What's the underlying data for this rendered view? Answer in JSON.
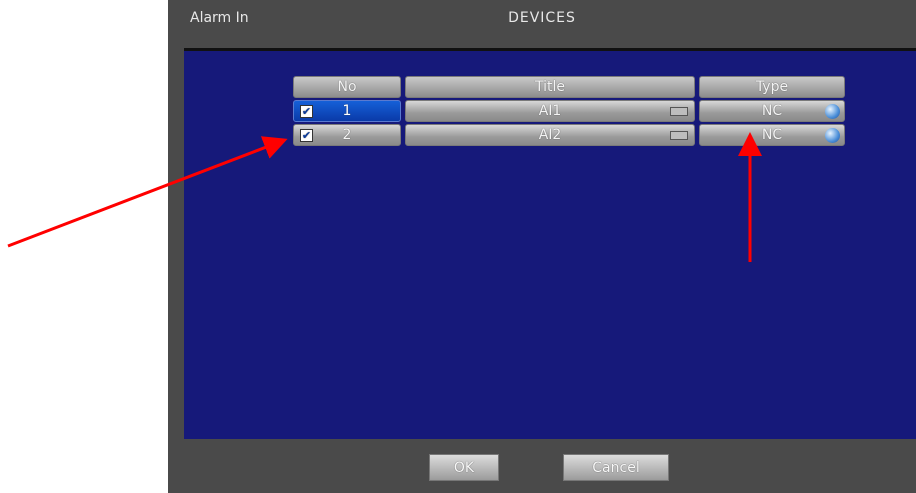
{
  "window": {
    "title_left": "Alarm In",
    "title_center": "DEVICES"
  },
  "table": {
    "headers": [
      "No",
      "Title",
      "Type"
    ],
    "rows": [
      {
        "no": "1",
        "title": "AI1",
        "type": "NC",
        "checked": true,
        "selected": true
      },
      {
        "no": "2",
        "title": "AI2",
        "type": "NC",
        "checked": true,
        "selected": false
      }
    ]
  },
  "buttons": {
    "ok": "OK",
    "cancel": "Cancel"
  },
  "icons": {
    "checkbox": "check-icon",
    "keyboard": "keyboard-icon",
    "type_selector": "globe-icon"
  },
  "colors": {
    "panel": "#16197a",
    "dialog": "#4a4a4a",
    "selected_row": "#1560d8",
    "annotation_arrow": "#ff0000"
  }
}
